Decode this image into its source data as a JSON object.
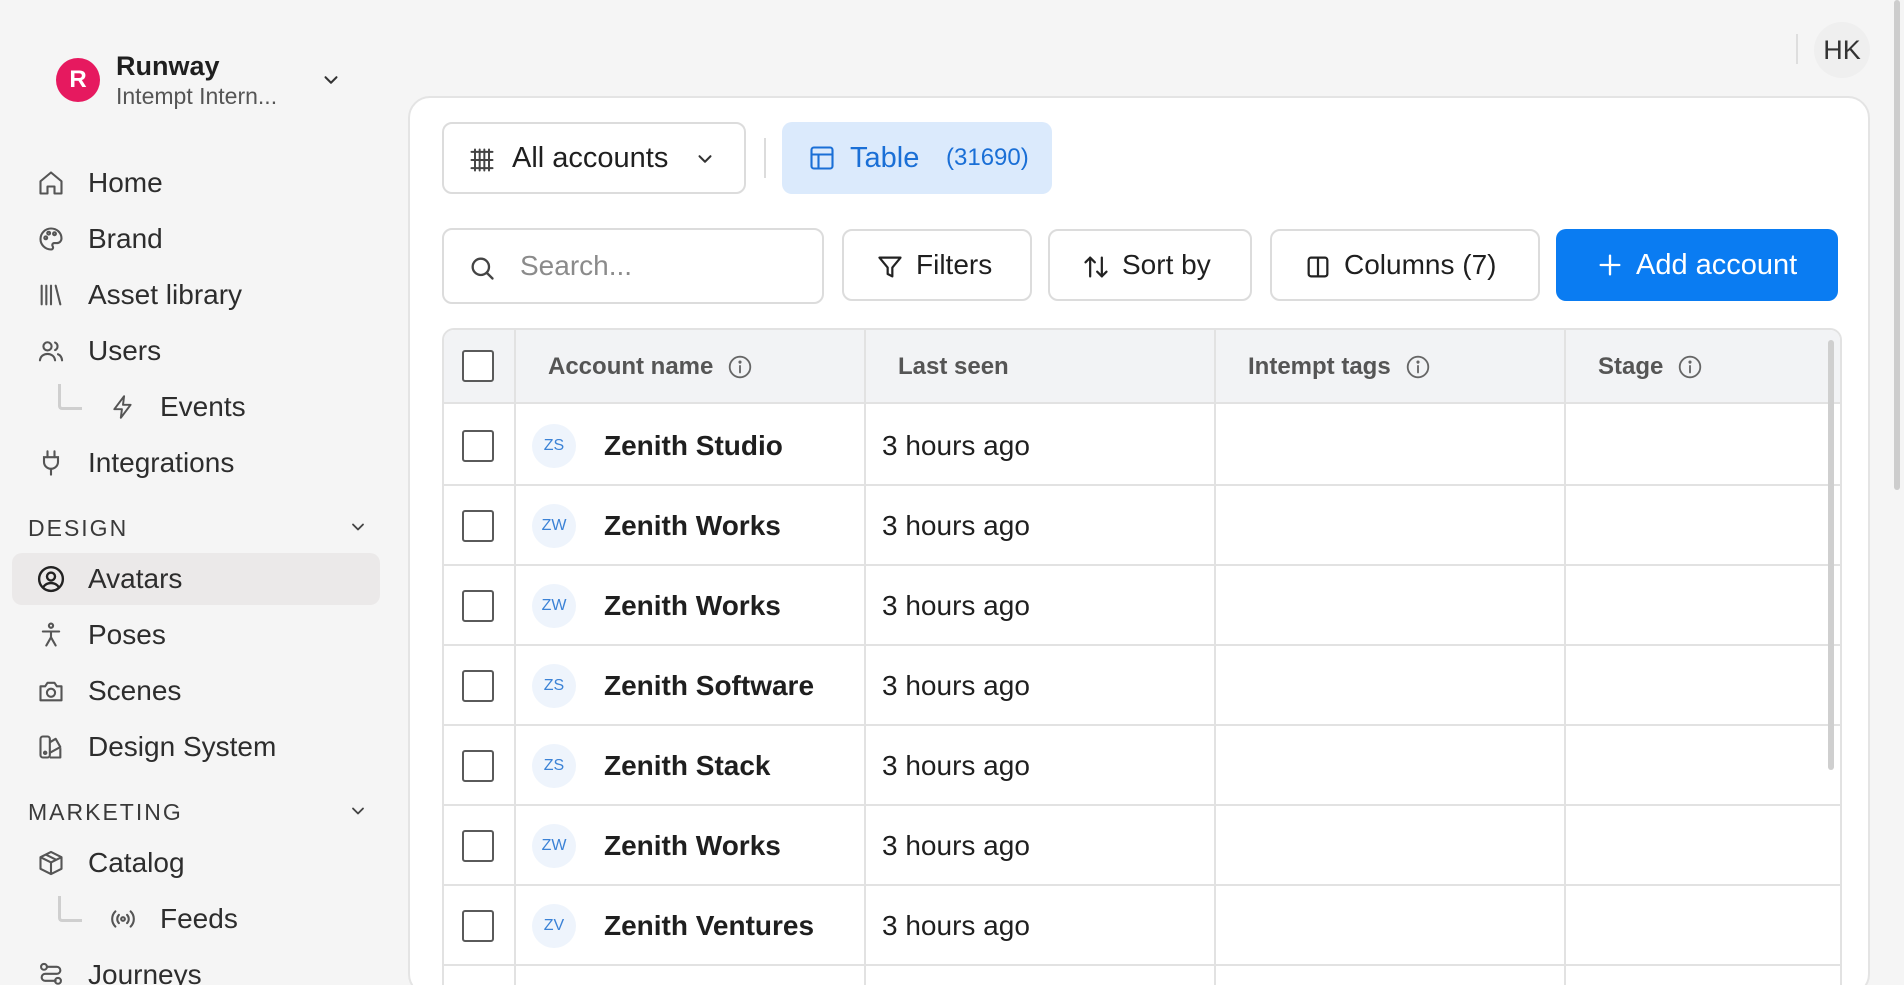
{
  "org": {
    "badge": "R",
    "name": "Runway",
    "subtitle": "Intempt Intern..."
  },
  "nav": {
    "top": [
      {
        "label": "Home",
        "icon": "home-icon"
      },
      {
        "label": "Brand",
        "icon": "palette-icon"
      },
      {
        "label": "Asset library",
        "icon": "library-icon"
      },
      {
        "label": "Users",
        "icon": "users-icon"
      },
      {
        "label": "Events",
        "icon": "lightning-icon"
      },
      {
        "label": "Integrations",
        "icon": "plug-icon"
      }
    ],
    "design_section": "DESIGN",
    "design": [
      {
        "label": "Avatars",
        "icon": "user-circle-icon"
      },
      {
        "label": "Poses",
        "icon": "figure-icon"
      },
      {
        "label": "Scenes",
        "icon": "camera-icon"
      },
      {
        "label": "Design System",
        "icon": "design-system-icon"
      }
    ],
    "marketing_section": "MARKETING",
    "marketing": [
      {
        "label": "Catalog",
        "icon": "box-icon"
      },
      {
        "label": "Feeds",
        "icon": "broadcast-icon"
      },
      {
        "label": "Journeys",
        "icon": "route-icon"
      }
    ]
  },
  "user": {
    "initials": "HK"
  },
  "toolbar": {
    "view_label": "All accounts",
    "table_label": "Table",
    "table_count": "(31690)",
    "search_placeholder": "Search...",
    "filters_label": "Filters",
    "sort_label": "Sort by",
    "columns_label": "Columns (7)",
    "add_label": "Add account"
  },
  "table": {
    "headers": [
      "Account name",
      "Last seen",
      "Intempt tags",
      "Stage"
    ],
    "rows": [
      {
        "initials": "ZS",
        "name": "Zenith Studio",
        "last_seen": "3 hours ago"
      },
      {
        "initials": "ZW",
        "name": "Zenith Works",
        "last_seen": "3 hours ago"
      },
      {
        "initials": "ZW",
        "name": "Zenith Works",
        "last_seen": "3 hours ago"
      },
      {
        "initials": "ZS",
        "name": "Zenith Software",
        "last_seen": "3 hours ago"
      },
      {
        "initials": "ZS",
        "name": "Zenith Stack",
        "last_seen": "3 hours ago"
      },
      {
        "initials": "ZW",
        "name": "Zenith Works",
        "last_seen": "3 hours ago"
      },
      {
        "initials": "ZV",
        "name": "Zenith Ventures",
        "last_seen": "3 hours ago"
      }
    ]
  },
  "colors": {
    "brand_badge": "#e6195f",
    "accent": "#0a7cf2",
    "tab_bg": "#dbeafc"
  }
}
